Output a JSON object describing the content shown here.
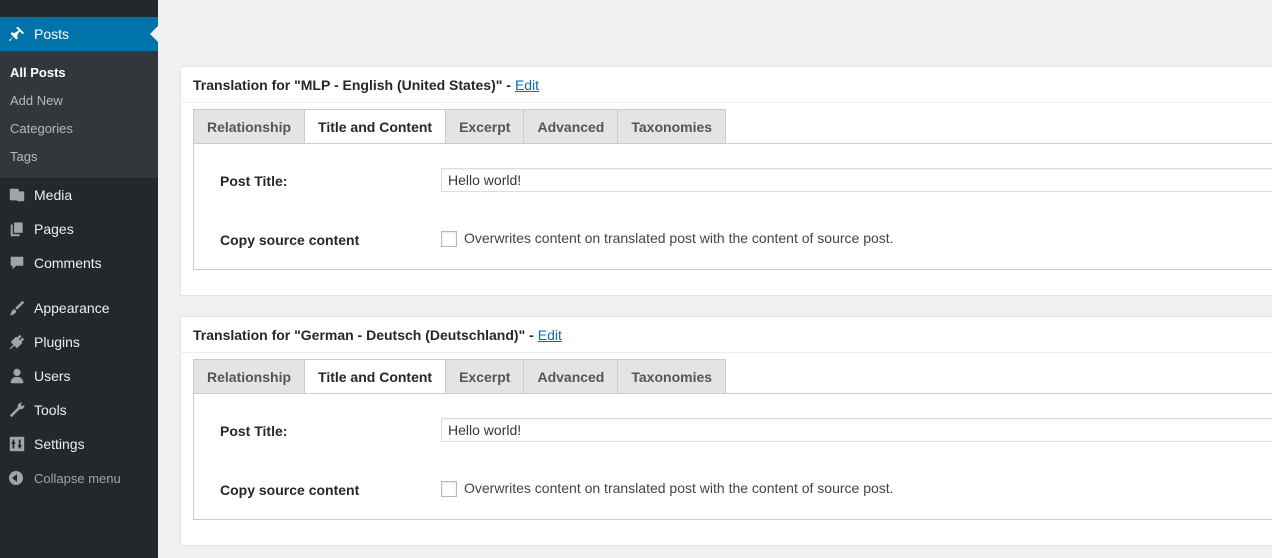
{
  "sidebar": {
    "posts": "Posts",
    "submenu": [
      "All Posts",
      "Add New",
      "Categories",
      "Tags"
    ],
    "items": [
      "Media",
      "Pages",
      "Comments",
      "Appearance",
      "Plugins",
      "Users",
      "Tools",
      "Settings"
    ],
    "collapse": "Collapse menu"
  },
  "boxes": [
    {
      "heading": "Translation for \"MLP - English (United States)\" -",
      "edit": "Edit",
      "tabs": [
        "Relationship",
        "Title and Content",
        "Excerpt",
        "Advanced",
        "Taxonomies"
      ],
      "active_tab": "Title and Content",
      "post_title_label": "Post Title:",
      "post_title_value": "Hello world!",
      "copy_label": "Copy source content",
      "copy_desc": "Overwrites content on translated post with the content of source post.",
      "copy_checked": false
    },
    {
      "heading": "Translation for \"German - Deutsch (Deutschland)\" -",
      "edit": "Edit",
      "tabs": [
        "Relationship",
        "Title and Content",
        "Excerpt",
        "Advanced",
        "Taxonomies"
      ],
      "active_tab": "Title and Content",
      "post_title_label": "Post Title:",
      "post_title_value": "Hello world!",
      "copy_label": "Copy source content",
      "copy_desc": "Overwrites content on translated post with the content of source post.",
      "copy_checked": false
    }
  ],
  "colors": {
    "sidebar": "#23282d",
    "submenu": "#32373c",
    "accent": "#0073aa"
  }
}
